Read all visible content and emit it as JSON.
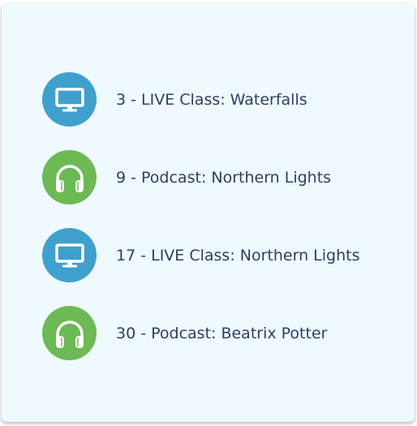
{
  "schedule": {
    "items": [
      {
        "label": "3 - LIVE Class: Waterfalls",
        "type": "live",
        "icon": "monitor-icon"
      },
      {
        "label": "9 - Podcast: Northern Lights",
        "type": "podcast",
        "icon": "headphones-icon"
      },
      {
        "label": "17 - LIVE Class: Northern Lights",
        "type": "live",
        "icon": "monitor-icon"
      },
      {
        "label": "30 - Podcast: Beatrix Potter",
        "type": "podcast",
        "icon": "headphones-icon"
      }
    ]
  },
  "colors": {
    "card_background": "#effaff",
    "live_icon_background": "#40a0cd",
    "podcast_icon_background": "#6db954",
    "text": "#2d3e63"
  }
}
